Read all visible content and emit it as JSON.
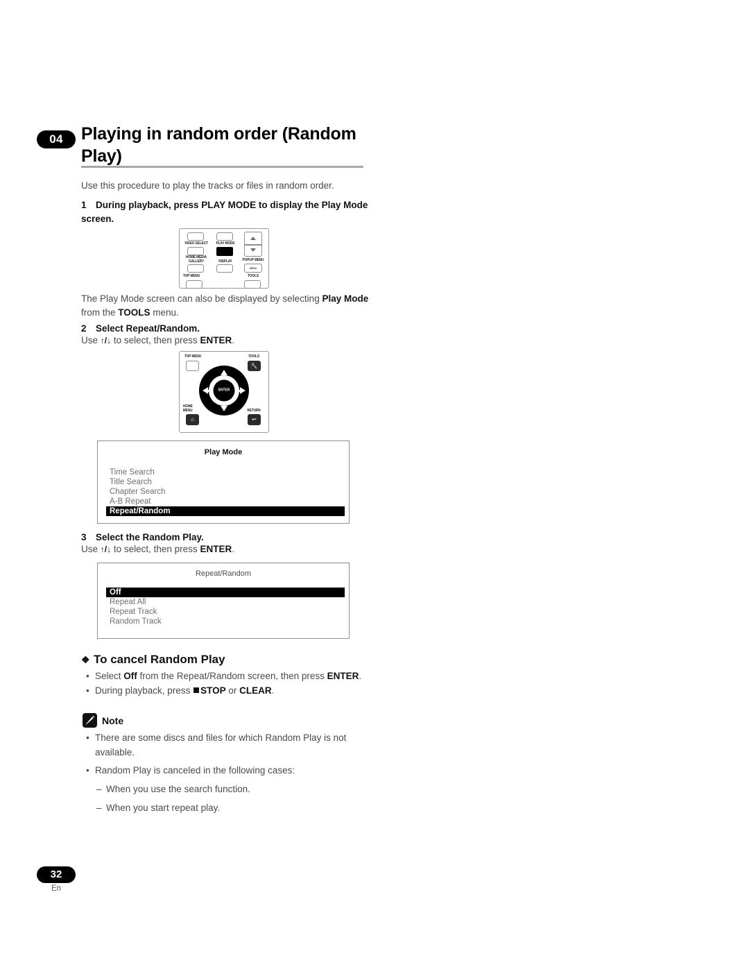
{
  "chapter": {
    "number": "04",
    "title": "Playing in random order (Random Play)"
  },
  "intro": "Use this procedure to play the tracks or files in random order.",
  "steps": [
    {
      "num": "1",
      "title": "During playback, press PLAY MODE to display the Play Mode screen."
    },
    {
      "num": "2",
      "title": "Select Repeat/Random.",
      "body_prefix": "Use ",
      "body_keys": "↑/↓",
      "body_mid": " to select, then press ",
      "body_bold": "ENTER",
      "body_suffix": "."
    },
    {
      "num": "3",
      "title": "Select the Random Play.",
      "body_prefix": "Use ",
      "body_keys": "↑/↓",
      "body_mid": " to select, then press ",
      "body_bold": "ENTER",
      "body_suffix": "."
    }
  ],
  "tools_paragraph": {
    "part1": "The Play Mode screen can also be displayed by selecting ",
    "bold1": "Play Mode",
    "part2": " from the ",
    "bold2": "TOOLS",
    "part3": " menu."
  },
  "remote_play_mode": {
    "labels": {
      "video_select": "VIDEO SELECT",
      "play_mode": "PLAY MODE",
      "home_media_gallery_line1": "HOME MEDIA",
      "home_media_gallery_line2": "GALLERY",
      "display": "DISPLAY",
      "popup_menu": "POPUP MENU",
      "menu_btn": "MENU",
      "top_menu": "TOP MENU",
      "tools": "TOOLS"
    }
  },
  "remote_dpad": {
    "labels": {
      "top_menu": "TOP MENU",
      "tools": "TOOLS",
      "home_menu_line1": "HOME",
      "home_menu_line2": "MENU",
      "return": "RETURN",
      "enter": "ENTER"
    }
  },
  "osd_play_mode": {
    "title": "Play Mode",
    "items": [
      {
        "label": "Time Search",
        "selected": false
      },
      {
        "label": "Title Search",
        "selected": false
      },
      {
        "label": "Chapter Search",
        "selected": false
      },
      {
        "label": "A-B Repeat",
        "selected": false
      },
      {
        "label": "Repeat/Random",
        "selected": true
      }
    ]
  },
  "osd_repeat_random": {
    "title": "Repeat/Random",
    "items": [
      {
        "label": "Off",
        "selected": true
      },
      {
        "label": "Repeat All",
        "selected": false
      },
      {
        "label": "Repeat Track",
        "selected": false
      },
      {
        "label": "Random Track",
        "selected": false
      }
    ]
  },
  "cancel_section": {
    "heading": "To cancel Random Play",
    "bullets": [
      {
        "part1": "Select ",
        "bold1": "Off",
        "part2": " from the Repeat/Random screen, then press ",
        "bold2": "ENTER",
        "part3": "."
      },
      {
        "part1": "During playback, press ",
        "bold1": "STOP",
        "part2": " or ",
        "bold2": "CLEAR",
        "part3": "."
      }
    ]
  },
  "note_section": {
    "label": "Note",
    "bullets": [
      "There are some discs and files for which Random Play is not available.",
      "Random Play is canceled in the following cases:"
    ],
    "sub_bullets": [
      "When you use the search function.",
      "When you start repeat play."
    ]
  },
  "footer": {
    "page_number": "32",
    "language": "En"
  }
}
